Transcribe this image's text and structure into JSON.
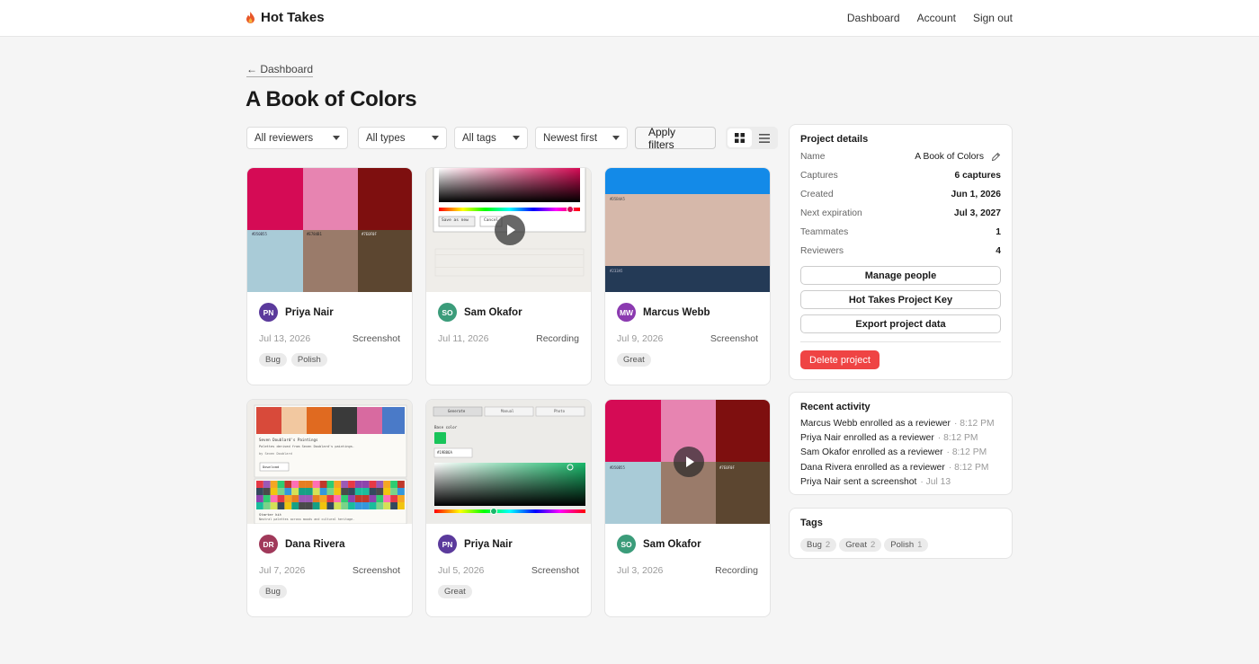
{
  "app": {
    "name": "Hot Takes"
  },
  "nav": {
    "dashboard": "Dashboard",
    "account": "Account",
    "signout": "Sign out"
  },
  "breadcrumb": {
    "back": "← Dashboard"
  },
  "page": {
    "title": "A Book of Colors"
  },
  "filters": {
    "reviewers": "All reviewers",
    "types": "All types",
    "tags": "All tags",
    "sort": "Newest first",
    "apply": "Apply filters"
  },
  "captures": [
    {
      "initials": "PN",
      "name": "Priya Nair",
      "date": "Jul 13, 2026",
      "kind": "Screenshot",
      "tags": [
        "Bug",
        "Polish"
      ],
      "avatar_color": "#5b3a9c"
    },
    {
      "initials": "SO",
      "name": "Sam Okafor",
      "date": "Jul 11, 2026",
      "kind": "Recording",
      "tags": [],
      "avatar_color": "#3b9c7a"
    },
    {
      "initials": "MW",
      "name": "Marcus Webb",
      "date": "Jul 9, 2026",
      "kind": "Screenshot",
      "tags": [
        "Great"
      ],
      "avatar_color": "#8b3ab0"
    },
    {
      "initials": "DR",
      "name": "Dana Rivera",
      "date": "Jul 7, 2026",
      "kind": "Screenshot",
      "tags": [
        "Bug"
      ],
      "avatar_color": "#a0395a"
    },
    {
      "initials": "PN",
      "name": "Priya Nair",
      "date": "Jul 5, 2026",
      "kind": "Screenshot",
      "tags": [
        "Great"
      ],
      "avatar_color": "#5b3a9c"
    },
    {
      "initials": "SO",
      "name": "Sam Okafor",
      "date": "Jul 3, 2026",
      "kind": "Recording",
      "tags": [],
      "avatar_color": "#3b9c7a"
    }
  ],
  "thumb_text": {
    "hex1": "#D50B55",
    "hex1b": "#E7 67A0 #13",
    "hex2": "#E784B1",
    "hex2b": "#F7B4 #E8A6",
    "hex3": "#7E0F0F",
    "hex3b": "#81 #8 #4F",
    "save_as_new": "Save as new",
    "cancel": "Cancel",
    "hex_blue": "#D5B4A5",
    "hex_navy": "#233A5",
    "painting_title": "Seven Doublard's Paintings",
    "painting_sub": "Palettes derived from Seven Doublard's paintings.",
    "painting_by": "by Seven Doublard",
    "download": "Download",
    "starter": "Starter kit",
    "starter_sub": "Neutral palettes across moods and cultural heritage.",
    "tab_generate": "Generate",
    "tab_manual": "Manual",
    "tab_photo": "Photo",
    "base_color": "Base color",
    "hex_green": "#19B86A"
  },
  "details": {
    "title": "Project details",
    "name_label": "Name",
    "name_value": "A Book of Colors",
    "captures_label": "Captures",
    "captures_value": "6 captures",
    "created_label": "Created",
    "created_value": "Jun 1, 2026",
    "expiration_label": "Next expiration",
    "expiration_value": "Jul 3, 2027",
    "teammates_label": "Teammates",
    "teammates_value": "1",
    "reviewers_label": "Reviewers",
    "reviewers_value": "4",
    "manage": "Manage people",
    "key": "Hot Takes Project Key",
    "export": "Export project data",
    "delete": "Delete project"
  },
  "activity": {
    "title": "Recent activity",
    "items": [
      {
        "text": "Marcus Webb enrolled as a reviewer",
        "time": "· 8:12 PM"
      },
      {
        "text": "Priya Nair enrolled as a reviewer",
        "time": "· 8:12 PM"
      },
      {
        "text": "Sam Okafor enrolled as a reviewer",
        "time": "· 8:12 PM"
      },
      {
        "text": "Dana Rivera enrolled as a reviewer",
        "time": "· 8:12 PM"
      },
      {
        "text": "Priya Nair sent a screenshot",
        "time": "· Jul 13"
      }
    ]
  },
  "tagpanel": {
    "title": "Tags",
    "items": [
      {
        "name": "Bug",
        "count": "2"
      },
      {
        "name": "Great",
        "count": "2"
      },
      {
        "name": "Polish",
        "count": "1"
      }
    ]
  },
  "colors": {
    "accent_red": "#ef4444",
    "flame": "#e8572a"
  }
}
